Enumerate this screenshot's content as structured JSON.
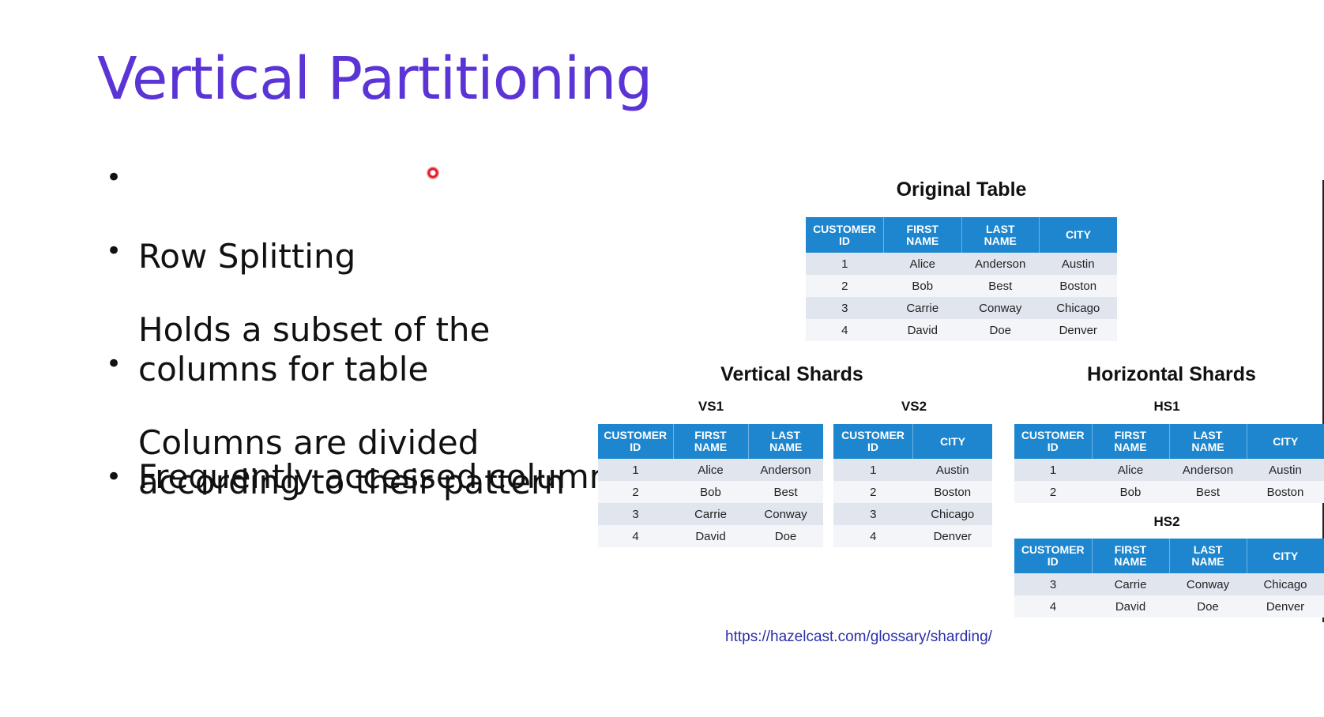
{
  "slide": {
    "title": "Vertical Partitioning",
    "title_color": "#5b34d6",
    "bullet_glyph": "•",
    "bullets": [
      "Row Splitting",
      "Holds a subset of the\ncolumns for table",
      "Columns are divided\naccording to their pattern",
      "Frequently accessed columns"
    ]
  },
  "figure": {
    "original_heading": "Original Table",
    "vertical_heading": "Vertical Shards",
    "horizontal_heading": "Horizontal Shards",
    "vs1_label": "VS1",
    "vs2_label": "VS2",
    "hs1_label": "HS1",
    "hs2_label": "HS2",
    "header_color": "#1d86cf",
    "original": {
      "headers": [
        "CUSTOMER\nID",
        "FIRST\nNAME",
        "LAST\nNAME",
        "CITY"
      ],
      "rows": [
        [
          "1",
          "Alice",
          "Anderson",
          "Austin"
        ],
        [
          "2",
          "Bob",
          "Best",
          "Boston"
        ],
        [
          "3",
          "Carrie",
          "Conway",
          "Chicago"
        ],
        [
          "4",
          "David",
          "Doe",
          "Denver"
        ]
      ]
    },
    "vs1": {
      "headers": [
        "CUSTOMER\nID",
        "FIRST\nNAME",
        "LAST\nNAME"
      ],
      "rows": [
        [
          "1",
          "Alice",
          "Anderson"
        ],
        [
          "2",
          "Bob",
          "Best"
        ],
        [
          "3",
          "Carrie",
          "Conway"
        ],
        [
          "4",
          "David",
          "Doe"
        ]
      ]
    },
    "vs2": {
      "headers": [
        "CUSTOMER\nID",
        "CITY"
      ],
      "rows": [
        [
          "1",
          "Austin"
        ],
        [
          "2",
          "Boston"
        ],
        [
          "3",
          "Chicago"
        ],
        [
          "4",
          "Denver"
        ]
      ]
    },
    "hs1": {
      "headers": [
        "CUSTOMER\nID",
        "FIRST\nNAME",
        "LAST\nNAME",
        "CITY"
      ],
      "rows": [
        [
          "1",
          "Alice",
          "Anderson",
          "Austin"
        ],
        [
          "2",
          "Bob",
          "Best",
          "Boston"
        ]
      ]
    },
    "hs2": {
      "headers": [
        "CUSTOMER\nID",
        "FIRST\nNAME",
        "LAST\nNAME",
        "CITY"
      ],
      "rows": [
        [
          "3",
          "Carrie",
          "Conway",
          "Chicago"
        ],
        [
          "4",
          "David",
          "Doe",
          "Denver"
        ]
      ]
    },
    "source_url": "https://hazelcast.com/glossary/sharding/"
  }
}
